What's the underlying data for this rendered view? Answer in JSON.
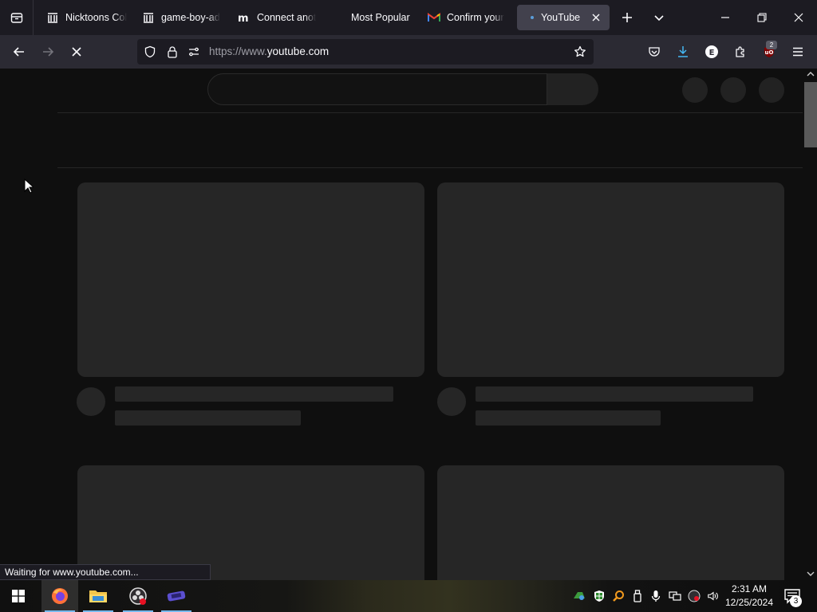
{
  "tabs": [
    {
      "title": "Nicktoons Col",
      "icon": "archive-icon"
    },
    {
      "title": "game-boy-ad",
      "icon": "archive-icon"
    },
    {
      "title": "Connect anot",
      "icon": "mastodon-icon"
    },
    {
      "title": "Most Popular",
      "icon": "blank-icon"
    },
    {
      "title": "Confirm your",
      "icon": "gmail-icon"
    },
    {
      "title": "YouTube",
      "icon": "loading-dot-icon",
      "active": true
    }
  ],
  "navbar": {
    "url_prefix": "https://www.",
    "url_domain": "youtube.com",
    "extension_badge": "2"
  },
  "status_text": "Waiting for www.youtube.com...",
  "taskbar": {
    "apps": [
      {
        "name": "firefox-app",
        "active": true
      },
      {
        "name": "file-explorer-app",
        "active": false
      },
      {
        "name": "obs-app",
        "active": false
      },
      {
        "name": "game-app",
        "active": false
      }
    ],
    "time": "2:31 AM",
    "date": "12/25/2024",
    "notification_count": "3"
  },
  "colors": {
    "accent": "#76b9ed",
    "chrome_bg": "#1c1b22",
    "toolbar_bg": "#2b2a33",
    "page_bg": "#0f0f0f",
    "placeholder": "#262626"
  }
}
